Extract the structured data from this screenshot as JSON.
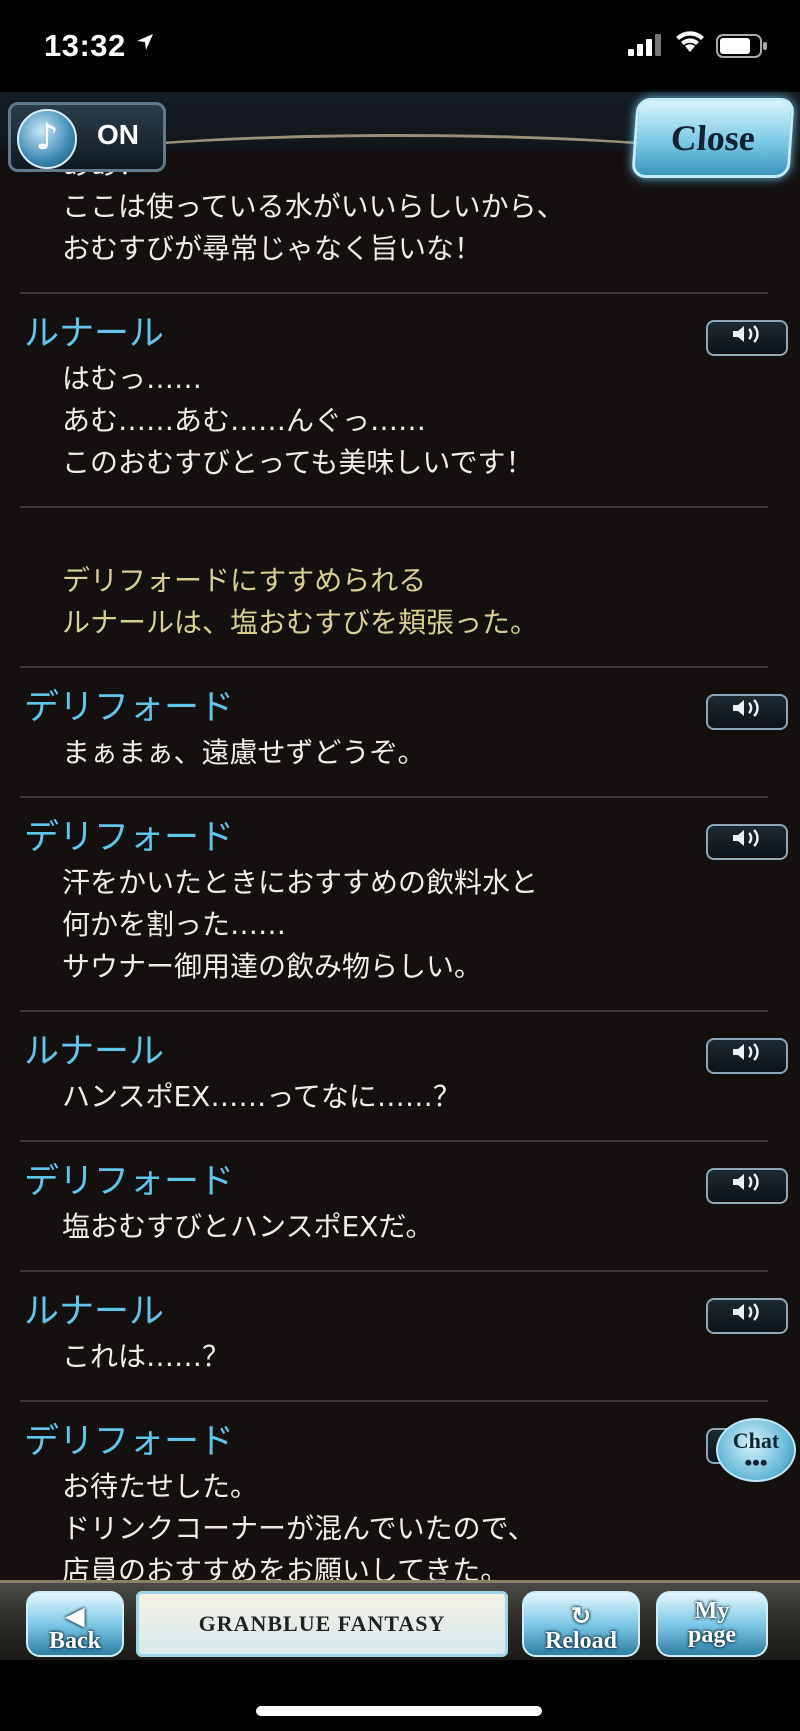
{
  "status_bar": {
    "time": "13:32"
  },
  "header": {
    "sound_label": "ON",
    "close_label": "Close"
  },
  "log": {
    "entries": [
      {
        "speaker": "",
        "lines": "ああ！\nここは使っている水がいいらしいから、\nおむすびが尋常じゃなく旨いな！",
        "voice": false
      },
      {
        "speaker": "ルナール",
        "lines": "はむっ……\nあむ……あむ……んぐっ……\nこのおむすびとっても美味しいです！",
        "voice": true
      },
      {
        "speaker": "",
        "lines": "デリフォードにすすめられる\nルナールは、塩おむすびを頬張った。",
        "voice": false,
        "narration": true
      },
      {
        "speaker": "デリフォード",
        "lines": "まぁまぁ、遠慮せずどうぞ。",
        "voice": true
      },
      {
        "speaker": "デリフォード",
        "lines": "汗をかいたときにおすすめの飲料水と\n何かを割った……\nサウナー御用達の飲み物らしい。",
        "voice": true
      },
      {
        "speaker": "ルナール",
        "lines": "ハンスポEX……ってなに……？",
        "voice": true
      },
      {
        "speaker": "デリフォード",
        "lines": "塩おむすびとハンスポEXだ。",
        "voice": true
      },
      {
        "speaker": "ルナール",
        "lines": "これは……？",
        "voice": true
      },
      {
        "speaker": "デリフォード",
        "lines": "お待たせした。\nドリンクコーナーが混んでいたので、\n店員のおすすめをお願いしてきた。",
        "voice": true
      }
    ],
    "voice_icon": "speaker-icon"
  },
  "chat": {
    "label": "Chat"
  },
  "bottom_bar": {
    "back_label": "Back",
    "logo_text": "GRANBLUE FANTASY",
    "reload_label": "Reload",
    "mypage_label_1": "My",
    "mypage_label_2": "page"
  },
  "colors": {
    "speaker": "#61c4ea",
    "narration": "#d9cf92",
    "text": "#f0ece6",
    "bg": "#141010"
  }
}
